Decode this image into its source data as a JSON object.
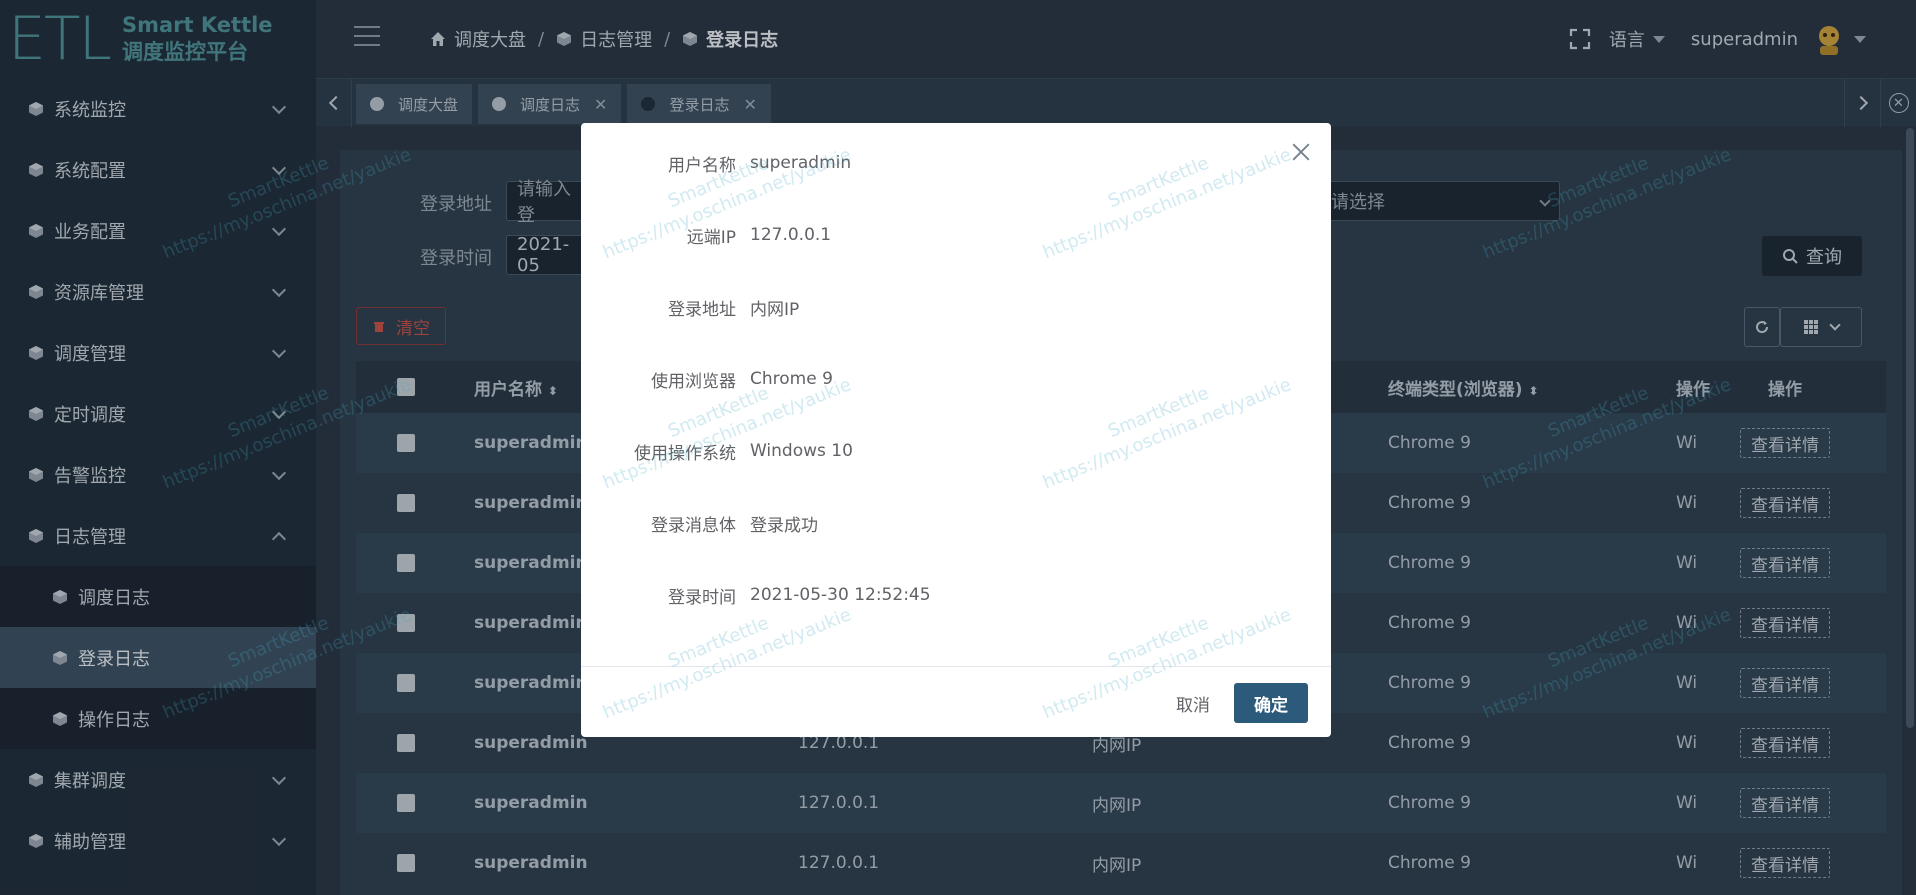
{
  "logo": {
    "mark": "ETL",
    "line1": "Smart Kettle",
    "line2": "调度监控平台"
  },
  "sidebar": {
    "items": [
      {
        "label": "系统监控",
        "expanded": false
      },
      {
        "label": "系统配置",
        "expanded": false
      },
      {
        "label": "业务配置",
        "expanded": false
      },
      {
        "label": "资源库管理",
        "expanded": false
      },
      {
        "label": "调度管理",
        "expanded": false
      },
      {
        "label": "定时调度",
        "expanded": false
      },
      {
        "label": "告警监控",
        "expanded": false
      },
      {
        "label": "日志管理",
        "expanded": true
      },
      {
        "label": "调度日志",
        "sub": true
      },
      {
        "label": "登录日志",
        "sub": true,
        "active": true
      },
      {
        "label": "操作日志",
        "sub": true
      },
      {
        "label": "集群调度",
        "expanded": false
      },
      {
        "label": "辅助管理",
        "expanded": false
      }
    ]
  },
  "header": {
    "breadcrumb": [
      "调度大盘",
      "日志管理",
      "登录日志"
    ],
    "language": "语言",
    "username": "superadmin"
  },
  "tabs": [
    {
      "label": "调度大盘",
      "closable": false
    },
    {
      "label": "调度日志",
      "closable": true
    },
    {
      "label": "登录日志",
      "closable": true,
      "active": true
    }
  ],
  "filters": {
    "login_address_label": "登录地址",
    "login_address_placeholder": "请输入登",
    "login_time_label": "登录时间",
    "login_time_value": "2021-05",
    "select_placeholder": "请选择",
    "query_label": "查询"
  },
  "toolbar": {
    "clear_label": "清空"
  },
  "table": {
    "headers": {
      "username": "用户名称",
      "browser": "终端类型(浏览器)",
      "os": "操作",
      "action": "操作"
    },
    "detail_label": "查看详情",
    "rows": [
      {
        "username": "superadmin",
        "ip": "",
        "address": "",
        "browser": "Chrome 9",
        "os": "Wi"
      },
      {
        "username": "superadmin",
        "ip": "",
        "address": "",
        "browser": "Chrome 9",
        "os": "Wi"
      },
      {
        "username": "superadmin",
        "ip": "",
        "address": "",
        "browser": "Chrome 9",
        "os": "Wi"
      },
      {
        "username": "superadmin",
        "ip": "",
        "address": "",
        "browser": "Chrome 9",
        "os": "Wi"
      },
      {
        "username": "superadmin",
        "ip": "",
        "address": "",
        "browser": "Chrome 9",
        "os": "Wi"
      },
      {
        "username": "superadmin",
        "ip": "127.0.0.1",
        "address": "内网IP",
        "browser": "Chrome 9",
        "os": "Wi"
      },
      {
        "username": "superadmin",
        "ip": "127.0.0.1",
        "address": "内网IP",
        "browser": "Chrome 9",
        "os": "Wi"
      },
      {
        "username": "superadmin",
        "ip": "127.0.0.1",
        "address": "内网IP",
        "browser": "Chrome 9",
        "os": "Wi"
      }
    ]
  },
  "dialog": {
    "fields": [
      {
        "label": "用户名称",
        "value": "superadmin"
      },
      {
        "label": "远端IP",
        "value": "127.0.0.1"
      },
      {
        "label": "登录地址",
        "value": "内网IP"
      },
      {
        "label": "使用浏览器",
        "value": "Chrome 9"
      },
      {
        "label": "使用操作系统",
        "value": "Windows 10"
      },
      {
        "label": "登录消息体",
        "value": "登录成功"
      },
      {
        "label": "登录时间",
        "value": "2021-05-30 12:52:45"
      }
    ],
    "cancel_label": "取消",
    "ok_label": "确定"
  },
  "watermark": {
    "line1": "SmartKettle",
    "line2": "https://my.oschina.net/yaukie"
  },
  "colors": {
    "accent": "#2c5a7a",
    "sidebar_bg": "#22303e",
    "logo": "#4f8f96",
    "danger": "#c0524a"
  }
}
